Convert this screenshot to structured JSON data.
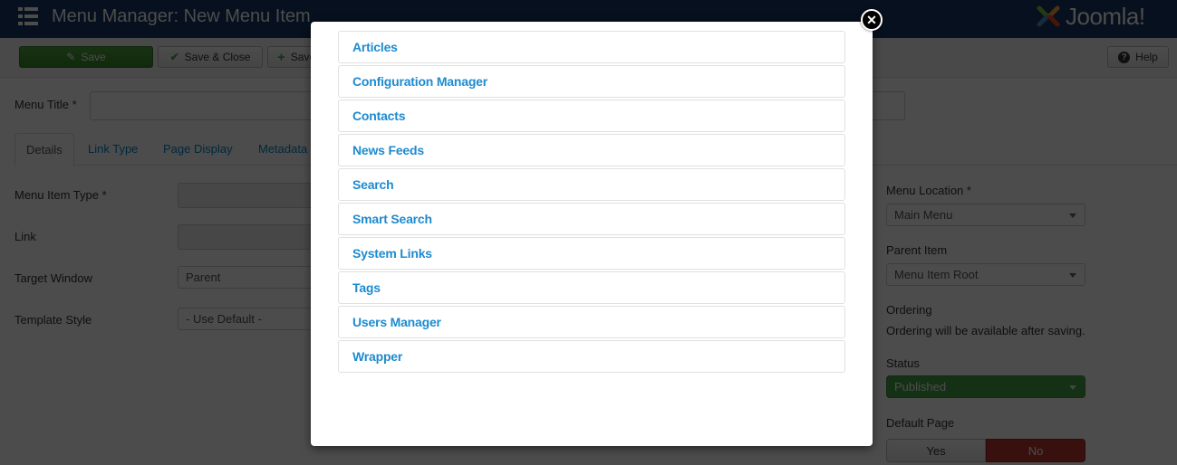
{
  "header": {
    "title": "Menu Manager: New Menu Item",
    "logo_text": "Joomla!",
    "background_color": "#1a3867"
  },
  "toolbar": {
    "save_label": "Save",
    "save_close_label": "Save & Close",
    "save_new_label": "Save & New",
    "help_label": "Help"
  },
  "form": {
    "menu_title_label": "Menu Title *",
    "menu_title_value": "",
    "tabs": [
      {
        "label": "Details",
        "active": true
      },
      {
        "label": "Link Type",
        "active": false
      },
      {
        "label": "Page Display",
        "active": false
      },
      {
        "label": "Metadata",
        "active": false
      }
    ],
    "fields": {
      "menu_item_type_label": "Menu Item Type *",
      "menu_item_type_value": "",
      "link_label": "Link",
      "link_value": "",
      "target_window_label": "Target Window",
      "target_window_value": "Parent",
      "template_style_label": "Template Style",
      "template_style_value": "- Use Default -"
    },
    "sidebar": {
      "menu_location_label": "Menu Location *",
      "menu_location_value": "Main Menu",
      "parent_item_label": "Parent Item",
      "parent_item_value": "Menu Item Root",
      "ordering_label": "Ordering",
      "ordering_note": "Ordering will be available after saving.",
      "status_label": "Status",
      "status_value": "Published",
      "default_page_label": "Default Page",
      "default_yes": "Yes",
      "default_no": "No",
      "default_selected": "No"
    }
  },
  "modal": {
    "items": [
      "Articles",
      "Configuration Manager",
      "Contacts",
      "News Feeds",
      "Search",
      "Smart Search",
      "System Links",
      "Tags",
      "Users Manager",
      "Wrapper"
    ],
    "close_icon": "close-icon",
    "link_color": "#1d8bcf"
  },
  "colors": {
    "success": "#46a546",
    "danger": "#bd362f",
    "link": "#0088cc"
  }
}
